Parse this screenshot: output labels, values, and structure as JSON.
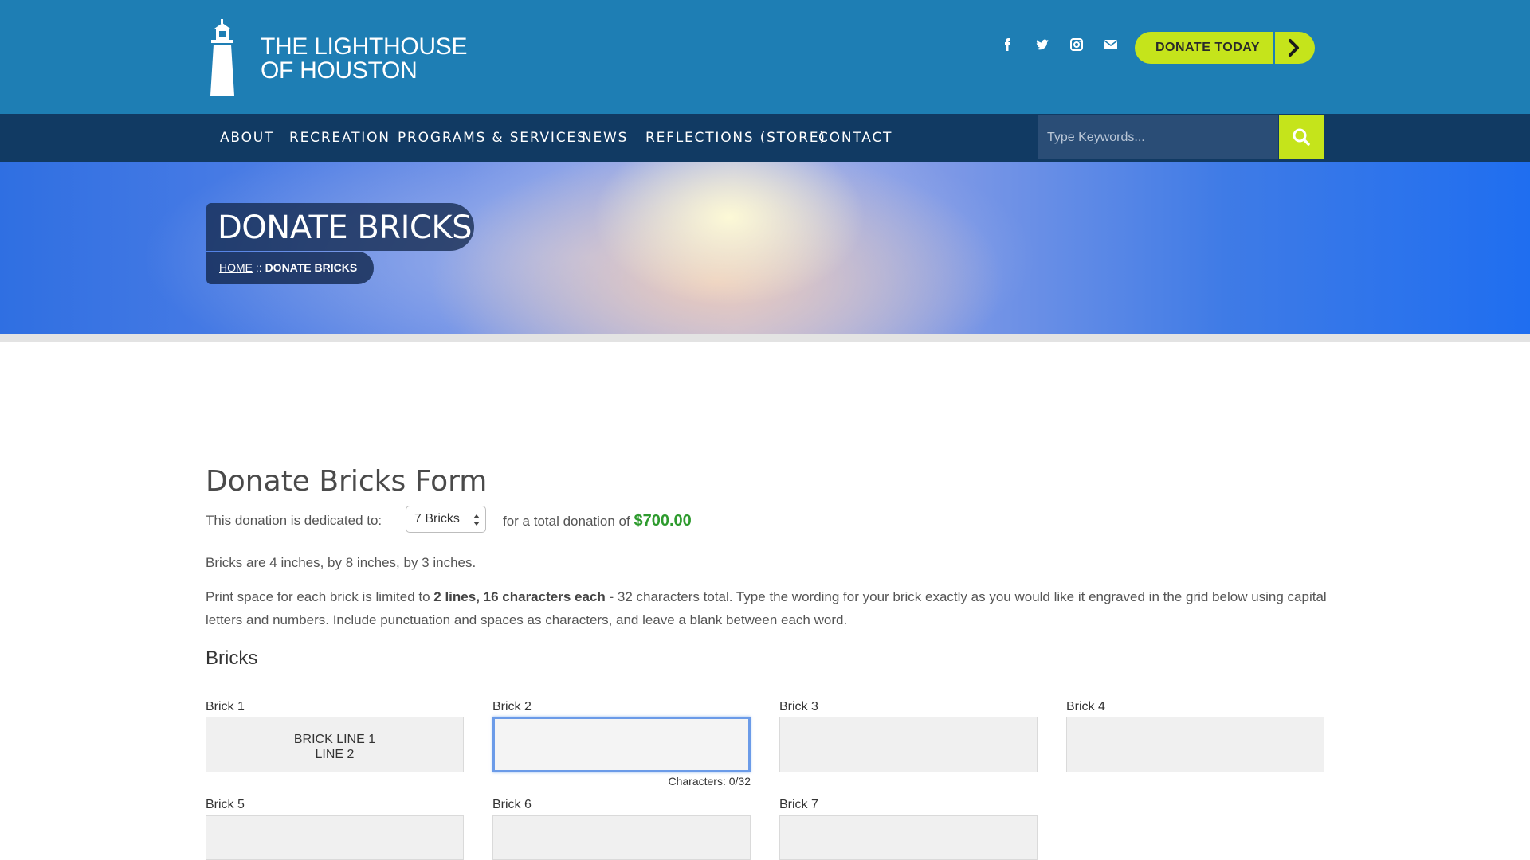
{
  "brand": {
    "logo_line1": "THE LIGHTHOUSE",
    "logo_line2": "OF HOUSTON"
  },
  "header": {
    "social_icons": [
      "facebook-icon",
      "twitter-icon",
      "instagram-icon",
      "email-icon"
    ],
    "donate_label": "DONATE TODAY"
  },
  "nav": {
    "items": [
      "ABOUT",
      "RECREATION",
      "PROGRAMS & SERVICES",
      "NEWS",
      "REFLECTIONS (STORE)",
      "CONTACT"
    ],
    "search_placeholder": "Type Keywords..."
  },
  "hero": {
    "title": "DONATE BRICKS",
    "crumb_home": "HOME",
    "crumb_sep": " :: ",
    "crumb_current": "DONATE BRICKS"
  },
  "form": {
    "title": "Donate Bricks Form",
    "dedicated_label": "This donation is dedicated to:",
    "bricks_selected": "7 Bricks",
    "total_prefix": "for a total donation of",
    "total_amount": "$700.00",
    "size_text": "Bricks are 4 inches, by 8 inches, by 3 inches.",
    "print_prefix": "Print space for each brick is limited to ",
    "print_bold": "2 lines, 16 characters each",
    "print_suffix": " - 32 characters total. Type the wording for your brick exactly as you would like it engraved in the grid below using capital letters and numbers. Include punctuation and spaces as characters, and leave a blank between each word.",
    "bricks_heading": "Bricks",
    "bricks": [
      {
        "label": "Brick 1",
        "placeholder": "BRICK LINE 1\nLINE 2"
      },
      {
        "label": "Brick 2",
        "placeholder": ""
      },
      {
        "label": "Brick 3",
        "placeholder": ""
      },
      {
        "label": "Brick 4",
        "placeholder": ""
      },
      {
        "label": "Brick 5",
        "placeholder": ""
      },
      {
        "label": "Brick 6",
        "placeholder": ""
      },
      {
        "label": "Brick 7",
        "placeholder": ""
      }
    ],
    "char_count": "Characters: 0/32"
  },
  "colors": {
    "header_bg": "#1e7eb4",
    "nav_bg": "#113a63",
    "accent_green": "#c5e41b",
    "total_green": "#2e9b2e"
  }
}
